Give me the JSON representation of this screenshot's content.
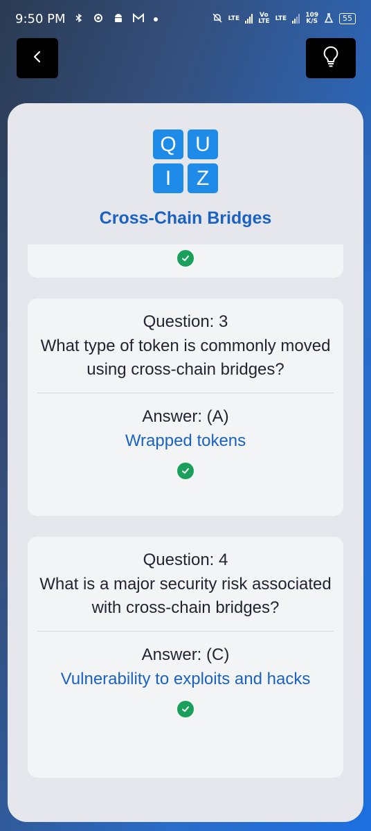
{
  "status_bar": {
    "time": "9:50 PM",
    "net_speed_value": "109",
    "net_speed_unit": "K/S",
    "battery": "55",
    "lte1": "LTE",
    "vo": "Vo",
    "vo_lte": "LTE",
    "lte2": "LTE"
  },
  "header": {
    "back_icon": "chevron-left-icon",
    "hint_icon": "lightbulb-icon"
  },
  "logo": {
    "tiles": [
      "Q",
      "U",
      "I",
      "Z"
    ],
    "tile_color": "#1f8be8"
  },
  "quiz": {
    "title": "Cross-Chain Bridges",
    "accent_color": "#1b62c0",
    "correct_color": "#1aa05a",
    "questions": [
      {
        "number_label": "Question: 3",
        "text": "What type of token is commonly moved using cross-chain bridges?",
        "answer_label": "Answer: (A)",
        "answer_text": "Wrapped tokens",
        "status_icon": "check-circle-icon"
      },
      {
        "number_label": "Question: 4",
        "text": "What is a major security risk associated with cross-chain bridges?",
        "answer_label": "Answer: (C)",
        "answer_text": "Vulnerability to exploits and hacks",
        "status_icon": "check-circle-icon"
      }
    ]
  }
}
